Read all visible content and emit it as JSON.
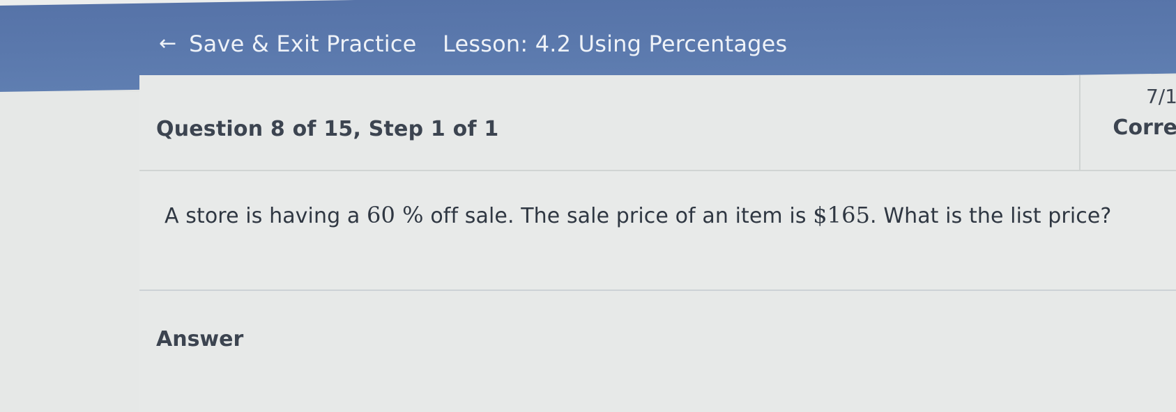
{
  "header": {
    "back_arrow": "←",
    "back_label": "Save & Exit Practice",
    "lesson_title": "Lesson: 4.2 Using Percentages"
  },
  "question": {
    "title": "Question 8 of 15,  Step 1 of 1",
    "score_value": "7/1",
    "score_label": "Corre"
  },
  "prompt": {
    "part1": "A store is having a ",
    "percent": "60 %",
    "part2": "  off sale. The sale price of an item is ",
    "price": "$165",
    "part3": ". What is the list price?"
  },
  "answer": {
    "label": "Answer"
  },
  "colors": {
    "header_bg": "#5a78ac",
    "header_text": "#eef2f8",
    "body_text": "#3c4450",
    "page_bg": "#e3e5e4"
  }
}
